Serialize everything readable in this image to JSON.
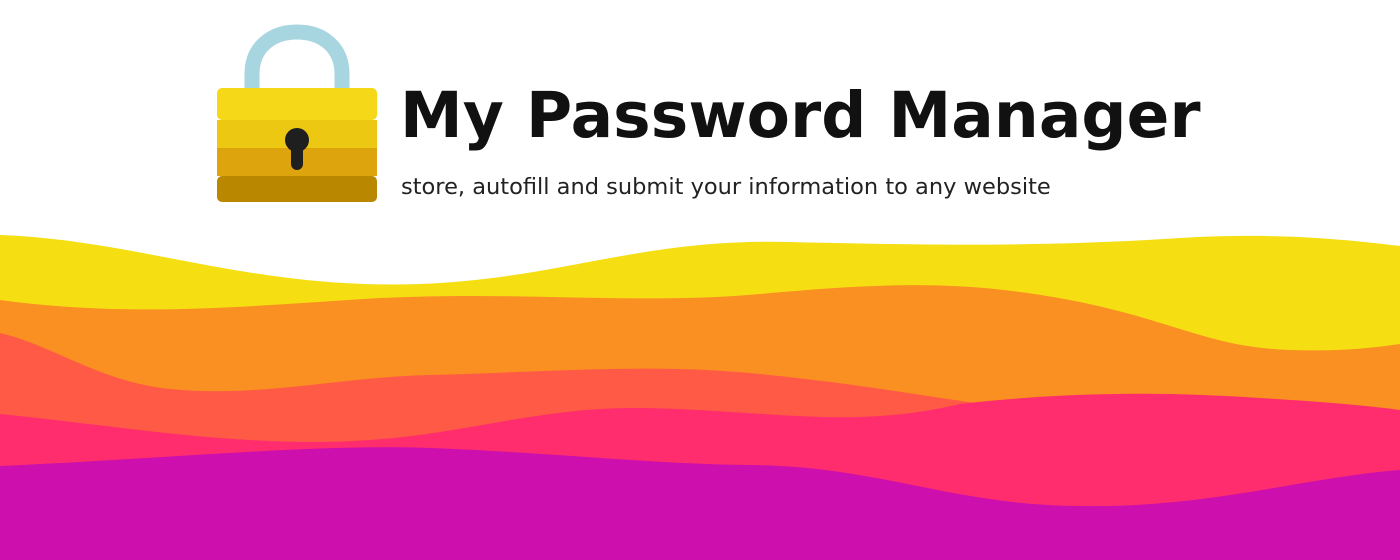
{
  "banner": {
    "title": "My Password Manager",
    "subtitle": "store, autofill and submit your information to any website",
    "logo_icon": "padlock-icon",
    "colors": {
      "background": "#ffffff",
      "title_text": "#111111",
      "subtitle_text": "#222222",
      "lock_shackle": "#a8d6e0",
      "lock_body_top": "#f5d918",
      "lock_body_upper_mid": "#ecc812",
      "lock_body_lower_mid": "#dda40e",
      "lock_body_bottom": "#b98700",
      "keyhole": "#1f1f1f",
      "wave_yellow": "#f5df12",
      "wave_orange": "#fa8f22",
      "wave_red_orange": "#ff5a45",
      "wave_pink": "#ff2d6d",
      "wave_magenta": "#cc0fad"
    }
  }
}
